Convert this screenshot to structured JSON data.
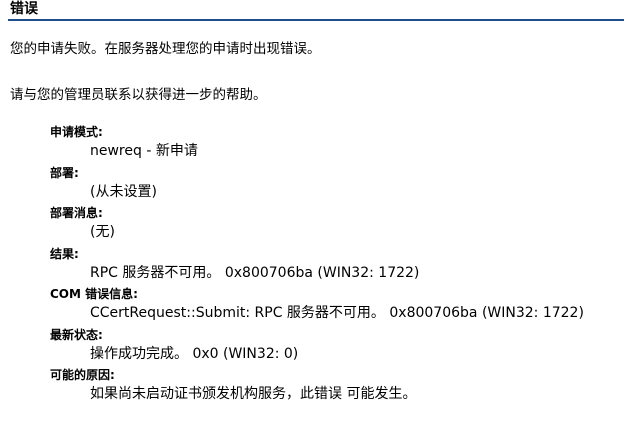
{
  "header": {
    "title": "错误"
  },
  "message": {
    "line1": "您的申请失败。在服务器处理您的申请时出现错误。",
    "line2": "请与您的管理员联系以获得进一步的帮助。"
  },
  "details": [
    {
      "label": "申请模式:",
      "value": "newreq - 新申请"
    },
    {
      "label": "部署:",
      "value": "(从未设置)"
    },
    {
      "label": "部署消息:",
      "value": "(无)"
    },
    {
      "label": "结果:",
      "value": "RPC 服务器不可用。 0x800706ba (WIN32: 1722)"
    },
    {
      "label": "COM 错误信息:",
      "value": "CCertRequest::Submit: RPC 服务器不可用。 0x800706ba (WIN32: 1722)"
    },
    {
      "label": "最新状态:",
      "value": "操作成功完成。 0x0 (WIN32: 0)"
    },
    {
      "label": "可能的原因:",
      "value": "如果尚未启动证书颁发机构服务，此错误 可能发生。"
    }
  ]
}
